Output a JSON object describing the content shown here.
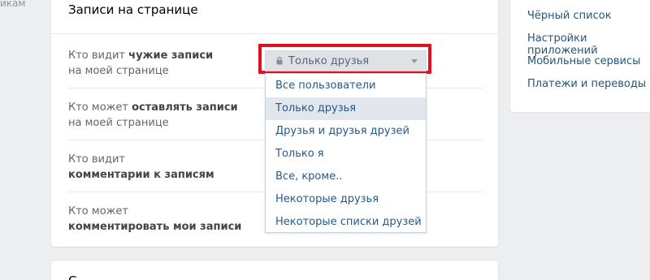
{
  "left_cut_text": "икам",
  "section": {
    "title": "Записи на странице",
    "rows": [
      {
        "prefix": "Кто видит ",
        "bold": "чужие записи",
        "suffix": "на моей странице"
      },
      {
        "prefix": "Кто может ",
        "bold": "оставлять записи",
        "suffix": "на моей странице"
      },
      {
        "prefix": "Кто видит",
        "bold": "комментарии к записям",
        "suffix": ""
      },
      {
        "prefix": "Кто может",
        "bold": "комментировать мои записи",
        "suffix": ""
      }
    ]
  },
  "select": {
    "icon": "lock-icon",
    "value": "Только друзья",
    "options": [
      "Все пользователи",
      "Только друзья",
      "Друзья и друзья друзей",
      "Только я",
      "Все, кроме..",
      "Некоторые друзья",
      "Некоторые списки друзей"
    ],
    "active_index": 1
  },
  "right_menu": {
    "items": [
      "Чёрный список",
      "Настройки приложений",
      "Мобильные сервисы",
      "Платежи и переводы"
    ]
  },
  "next_section": {
    "title_partial": "С"
  },
  "colors": {
    "highlight": "#e0101f",
    "link": "#2a5885",
    "background": "#edeef0"
  }
}
